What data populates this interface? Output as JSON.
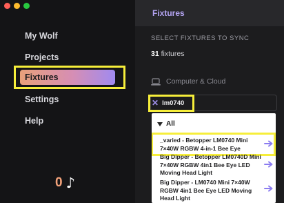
{
  "window": {
    "traffic_lights": [
      "#ff5f57",
      "#febc2e",
      "#28c840"
    ]
  },
  "sidebar": {
    "items": [
      {
        "label": "My Wolf"
      },
      {
        "label": "Projects"
      },
      {
        "label": "Fixtures",
        "active": true
      },
      {
        "label": "Settings"
      },
      {
        "label": "Help"
      }
    ],
    "counter": {
      "value": "0",
      "icon": "music-note-icon",
      "glyph": "♪"
    }
  },
  "main": {
    "title": "Fixtures",
    "section_label": "SELECT FIXTURES TO SYNC",
    "fixture_count": {
      "number": "31",
      "suffix": " fixtures"
    },
    "sync_target": {
      "icon": "laptop-icon",
      "label": "Computer & Cloud"
    },
    "filter_chip": {
      "label": "lm0740",
      "remove_glyph": "✕"
    },
    "dropdown": {
      "group_label": "All",
      "items": [
        {
          "label": "_varied - Betopper LM0740 Mini 7×40W RGBW 4-in-1 Bee Eye"
        },
        {
          "label": "Big Dipper - Betopper LM0740D Mini 7×40W RGBW 4in1 Bee Eye LED Moving Head Light"
        },
        {
          "label": "Big Dipper - LM0740 Mini 7×40W RGBW 4in1 Bee Eye LED Moving Head Light"
        }
      ]
    }
  },
  "colors": {
    "highlight": "#f6ee3a",
    "accent_purple": "#b4a4f2",
    "counter_orange": "#f3a27a"
  }
}
